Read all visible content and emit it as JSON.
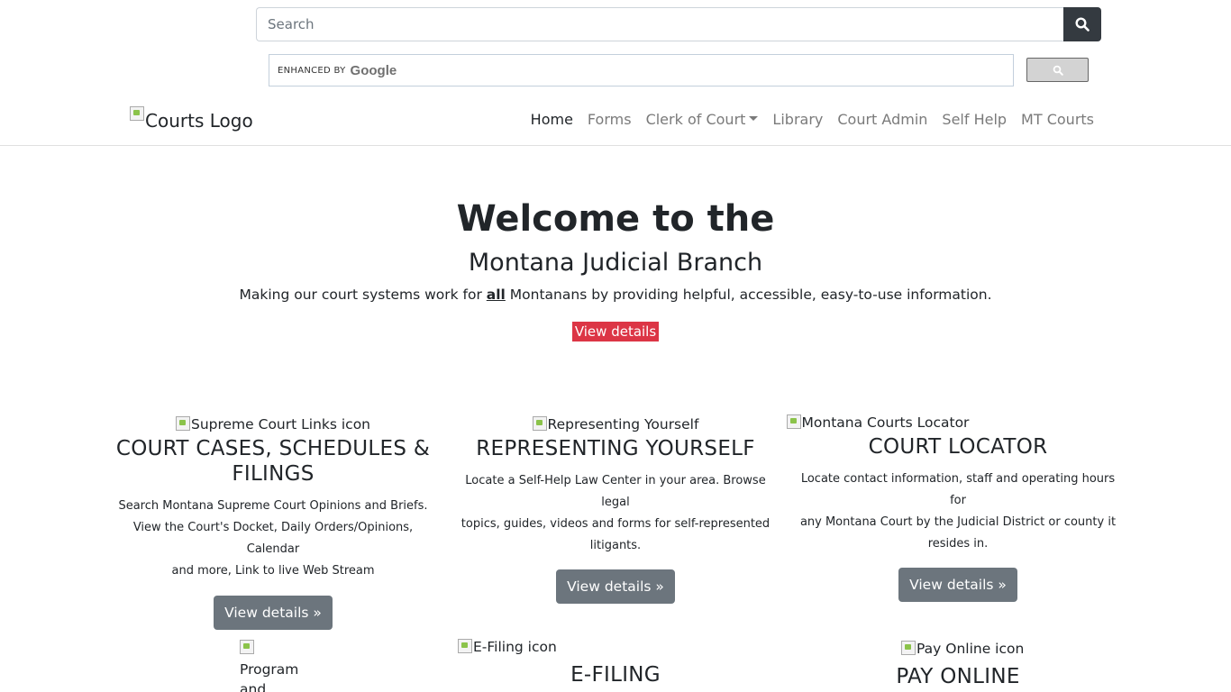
{
  "search": {
    "placeholder": "Search"
  },
  "gcse": {
    "enhanced_label": "ENHANCED BY",
    "google_label": "Google"
  },
  "header": {
    "logo_alt": "Courts Logo",
    "nav": [
      {
        "label": "Home",
        "active": true
      },
      {
        "label": "Forms"
      },
      {
        "label": "Clerk of Court",
        "dropdown": true
      },
      {
        "label": "Library"
      },
      {
        "label": "Court Admin"
      },
      {
        "label": "Self Help"
      },
      {
        "label": "MT Courts"
      }
    ]
  },
  "hero": {
    "title": "Welcome to the",
    "subtitle": "Montana Judicial Branch",
    "text_before": "Making our court systems work for ",
    "text_bold": "all",
    "text_after": " Montanans by providing helpful, accessible, easy-to-use information.",
    "button": "View details »"
  },
  "cards": [
    {
      "img_alt": "Supreme Court Links icon",
      "title_line1": "COURT CASES, SCHEDULES &",
      "title_line2": "FILINGS",
      "text_line1": "Search Montana Supreme Court Opinions and Briefs.",
      "text_line2": "View the Court's Docket, Daily Orders/Opinions, Calendar",
      "text_line3": "and more, Link to live Web Stream",
      "button": "View details »"
    },
    {
      "img_alt": "Representing Yourself",
      "title": "REPRESENTING YOURSELF",
      "text_line1": "Locate a Self-Help Law Center in your area. Browse legal",
      "text_line2": "topics, guides, videos and forms for self-represented",
      "text_line3": "litigants.",
      "button": "View details »"
    },
    {
      "img_alt": "Montana Courts Locator",
      "title": "COURT LOCATOR",
      "text_line1": "Locate contact information, staff and operating hours for",
      "text_line2": "any Montana Court by the Judicial District or county it",
      "text_line3": "resides in.",
      "button": "View details »"
    }
  ],
  "cards_row2": [
    {
      "img_alt_line1": "Program",
      "img_alt_line2": "and"
    },
    {
      "img_alt": "E-Filing icon",
      "title": "E-FILING"
    },
    {
      "img_alt": "Pay Online icon",
      "title": "PAY ONLINE"
    }
  ]
}
